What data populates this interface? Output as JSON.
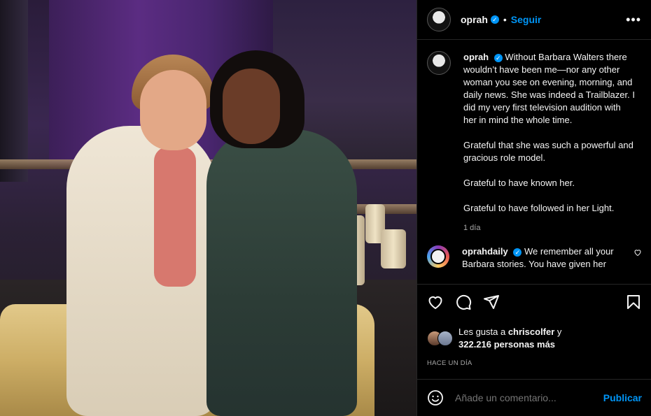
{
  "post": {
    "username": "oprah",
    "follow_label": "Seguir",
    "more_label": "•••"
  },
  "caption": {
    "username": "oprah",
    "text1": "Without Barbara Walters there wouldn’t have been me—nor any other woman you see on evening, morning, and daily news. She was indeed a Trailblazer. I did my very first television audition with her in mind the whole time.",
    "text2": "Grateful that she was such a powerful and gracious role model.",
    "text3": "Grateful to have known her.",
    "text4": "Grateful to have followed in her Light.",
    "time": "1 día"
  },
  "comment": {
    "username": "oprahdaily",
    "text": "We remember all your Barbara stories. You have given her"
  },
  "likes": {
    "prefix": "Les gusta a ",
    "user": "chriscolfer",
    "suffix": " y",
    "count": "322.216 personas más"
  },
  "timestamp": "HACE UN DÍA",
  "compose": {
    "placeholder": "Añade un comentario...",
    "publish_label": "Publicar"
  },
  "colors": {
    "accent": "#0095f6",
    "muted": "#a8a8a8",
    "background": "#000000"
  },
  "icons": [
    "verified-icon",
    "more-icon",
    "heart-icon",
    "comment-icon",
    "share-icon",
    "save-icon",
    "emoji-icon"
  ]
}
